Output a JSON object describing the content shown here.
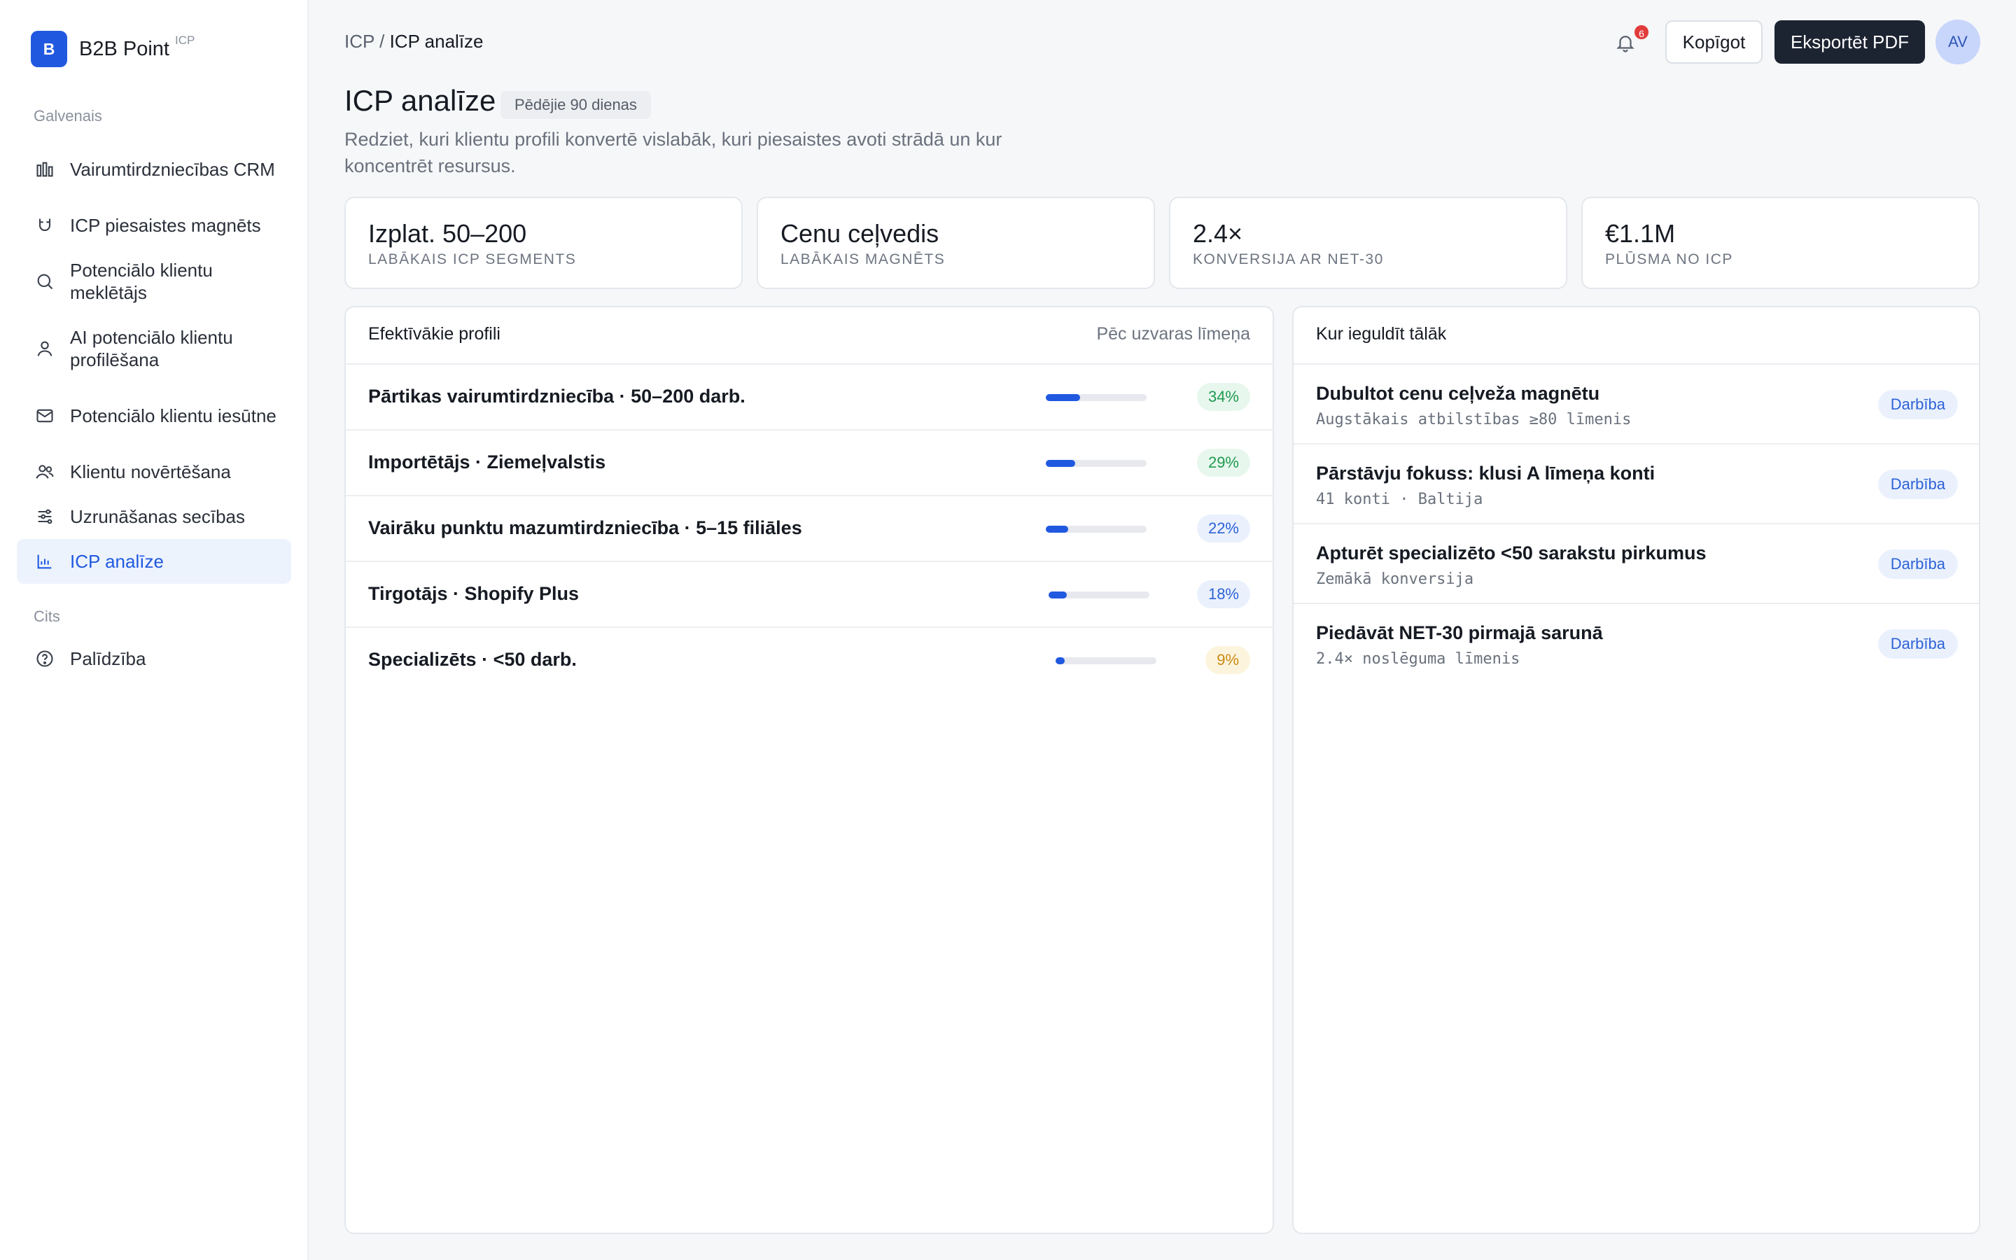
{
  "brand": {
    "logo_letter": "B",
    "name": "B2B Point",
    "tag": "ICP"
  },
  "sidebar": {
    "section_main": "Galvenais",
    "section_other": "Cits",
    "items": [
      {
        "label": "Vairumtirdzniecības CRM",
        "icon": "bar-chart-icon"
      },
      {
        "label": "ICP piesaistes magnēts",
        "icon": "magnet-icon"
      },
      {
        "label": "Potenciālo klientu meklētājs",
        "icon": "search-icon"
      },
      {
        "label": "AI potenciālo klientu profilēšana",
        "icon": "user-icon"
      },
      {
        "label": "Potenciālo klientu iesūtne",
        "icon": "mail-icon"
      },
      {
        "label": "Klientu novērtēšana",
        "icon": "users-icon"
      },
      {
        "label": "Uzrunāšanas secības",
        "icon": "sliders-icon"
      },
      {
        "label": "ICP analīze",
        "icon": "analytics-icon",
        "active": true
      },
      {
        "label": "Palīdzība",
        "icon": "help-icon"
      }
    ]
  },
  "header": {
    "breadcrumb_root": "ICP",
    "breadcrumb_sep": "/",
    "breadcrumb_current": "ICP analīze",
    "notifications": "6",
    "share_label": "Kopīgot",
    "export_label": "Eksportēt PDF",
    "avatar": "AV"
  },
  "page": {
    "title": "ICP analīze",
    "period": "Pēdējie 90 dienas",
    "description": "Redziet, kuri klientu profili konvertē vislabāk, kuri piesaistes avoti strādā un kur koncentrēt resursus."
  },
  "stats": [
    {
      "value": "Izplat. 50–200",
      "label": "LABĀKAIS ICP SEGMENTS"
    },
    {
      "value": "Cenu ceļvedis",
      "label": "LABĀKAIS MAGNĒTS"
    },
    {
      "value": "2.4×",
      "label": "KONVERSIJA AR NET-30"
    },
    {
      "value": "€1.1M",
      "label": "PLŪSMA NO ICP"
    }
  ],
  "profiles": {
    "title": "Efektīvākie profili",
    "sort_label": "Pēc uzvaras līmeņa",
    "rows": [
      {
        "name": "Pārtikas vairumtirdzniecība · 50–200 darb.",
        "value": 34,
        "display": "34%",
        "tone": "green"
      },
      {
        "name": "Importētājs · Ziemeļvalstis",
        "value": 29,
        "display": "29%",
        "tone": "green"
      },
      {
        "name": "Vairāku punktu mazumtirdzniecība · 5–15 filiāles",
        "value": 22,
        "display": "22%",
        "tone": "blue"
      },
      {
        "name": "Tirgotājs · Shopify Plus",
        "value": 18,
        "display": "18%",
        "tone": "blue"
      },
      {
        "name": "Specializēts · <50 darb.",
        "value": 9,
        "display": "9%",
        "tone": "amber"
      }
    ]
  },
  "invest": {
    "title": "Kur ieguldīt tālāk",
    "action_label": "Darbība",
    "rows": [
      {
        "title": "Dubultot cenu ceļveža magnētu",
        "sub": "Augstākais atbilstības ≥80 līmenis"
      },
      {
        "title": "Pārstāvju fokuss: klusi A līmeņa konti",
        "sub": "41 konti · Baltija"
      },
      {
        "title": "Apturēt specializēto <50 sarakstu pirkumus",
        "sub": "Zemākā konversija"
      },
      {
        "title": "Piedāvāt NET-30 pirmajā sarunā",
        "sub": "2.4× noslēguma līmenis"
      }
    ]
  },
  "colors": {
    "accent": "#2059e0",
    "dark_button": "#1c2331",
    "notification": "#e23b3b"
  }
}
